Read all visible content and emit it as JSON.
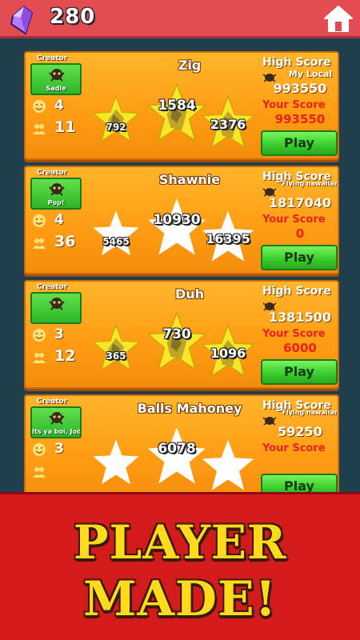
{
  "header": {
    "gem_count": "280",
    "home_icon": "home-icon",
    "gem_icon": "gem-icon"
  },
  "cards": [
    {
      "creator_label": "Creator",
      "creator_name": "Sadie",
      "title": "Zig",
      "likes": "4",
      "players": "11",
      "star_style": "gold",
      "star_values": [
        "792",
        "1584",
        "2376"
      ],
      "high_score_label": "High Score",
      "high_score_holder": "My Local",
      "high_score": "993550",
      "your_score_label": "Your Score",
      "your_score": "993550",
      "play_label": "Play"
    },
    {
      "creator_label": "Creator",
      "creator_name": "Pop!",
      "title": "Shawnie",
      "likes": "4",
      "players": "36",
      "star_style": "white",
      "star_values": [
        "5465",
        "10930",
        "16395"
      ],
      "high_score_label": "High Score",
      "high_score_holder": "Flying hawaiian",
      "high_score": "1817040",
      "your_score_label": "Your Score",
      "your_score": "0",
      "play_label": "Play"
    },
    {
      "creator_label": "Creator",
      "creator_name": "",
      "title": "Duh",
      "likes": "3",
      "players": "12",
      "star_style": "gold",
      "star_values": [
        "365",
        "730",
        "1096"
      ],
      "high_score_label": "High Score",
      "high_score_holder": "",
      "high_score": "1381500",
      "your_score_label": "Your Score",
      "your_score": "6000",
      "play_label": "Play"
    },
    {
      "creator_label": "Creator",
      "creator_name": "Its ya boi, Jodi",
      "title": "Balls Mahoney",
      "likes": "3",
      "players": "",
      "star_style": "white",
      "star_values": [
        "",
        "6078",
        ""
      ],
      "high_score_label": "High Score",
      "high_score_holder": "Flying hawaiian",
      "high_score": "59250",
      "your_score_label": "Your Score",
      "your_score": "",
      "play_label": "Play"
    }
  ],
  "banner": {
    "line1": "PLAYER",
    "line2": "MADE!"
  },
  "colors": {
    "topbar": "#e24c52",
    "card": "#ff9c14",
    "play_button": "#3bcf2e",
    "your_score": "#e82318",
    "banner_bg": "#d41b1b",
    "banner_text": "#ffdb1c"
  }
}
